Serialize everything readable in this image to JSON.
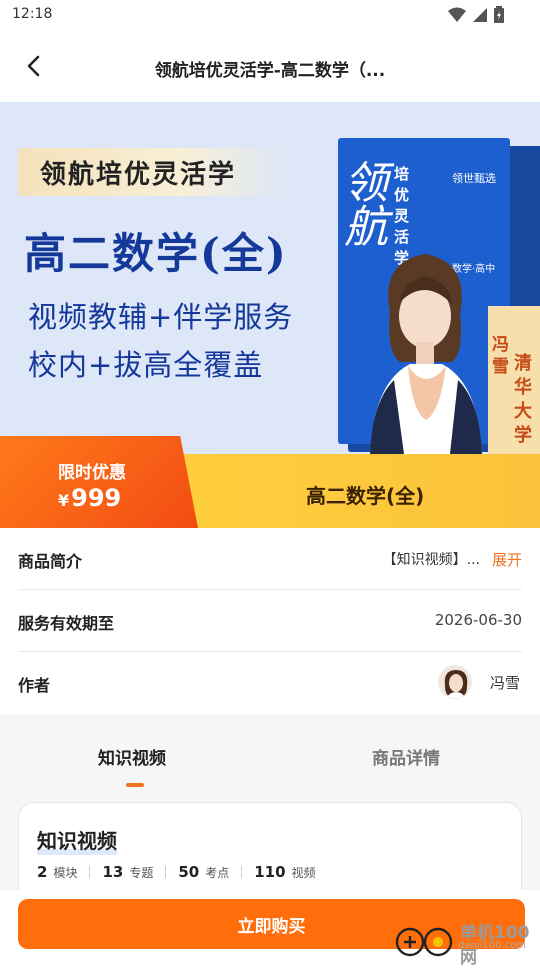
{
  "status_bar": {
    "time": "12:18"
  },
  "nav": {
    "title": "领航培优灵活学-高二数学（..."
  },
  "banner": {
    "brand": "领航培优灵活学",
    "subject": "高二数学(全)",
    "slogan_line1": "视频教辅+伴学服务",
    "slogan_line2": "校内+拔高全覆盖",
    "book_script": "领航",
    "book_title_vertical": "培优灵活学",
    "book_brand": "领世甄选",
    "book_tag": "数学·高中",
    "teacher_name": "冯雪",
    "teacher_school": "清华大学"
  },
  "price": {
    "label": "限时优惠",
    "currency": "¥",
    "amount": "999",
    "product_name": "高二数学(全)"
  },
  "info": {
    "intro_label": "商品简介",
    "intro_text": "【知识视频】...",
    "expand_label": "展开",
    "valid_label": "服务有效期至",
    "valid_date": "2026-06-30",
    "author_label": "作者",
    "author_name": "冯雪"
  },
  "tabs": [
    {
      "label": "知识视频",
      "active": true
    },
    {
      "label": "商品详情",
      "active": false
    }
  ],
  "card": {
    "title": "知识视频",
    "stats": [
      {
        "value": "2",
        "unit": "模块"
      },
      {
        "value": "13",
        "unit": "专题"
      },
      {
        "value": "50",
        "unit": "考点"
      },
      {
        "value": "110",
        "unit": "视频"
      }
    ]
  },
  "buy_button": {
    "label": "立即购买"
  },
  "watermark": {
    "text": "单机100网",
    "url": "danji100.com"
  },
  "colors": {
    "accent": "#ff6e0b",
    "brand_blue": "#15399a",
    "price_red": "#f24b13",
    "price_yellow": "#ffcf3d"
  },
  "icons": {
    "back": "chevron-left-icon",
    "wifi": "wifi-icon",
    "signal": "signal-icon",
    "battery": "battery-icon"
  }
}
